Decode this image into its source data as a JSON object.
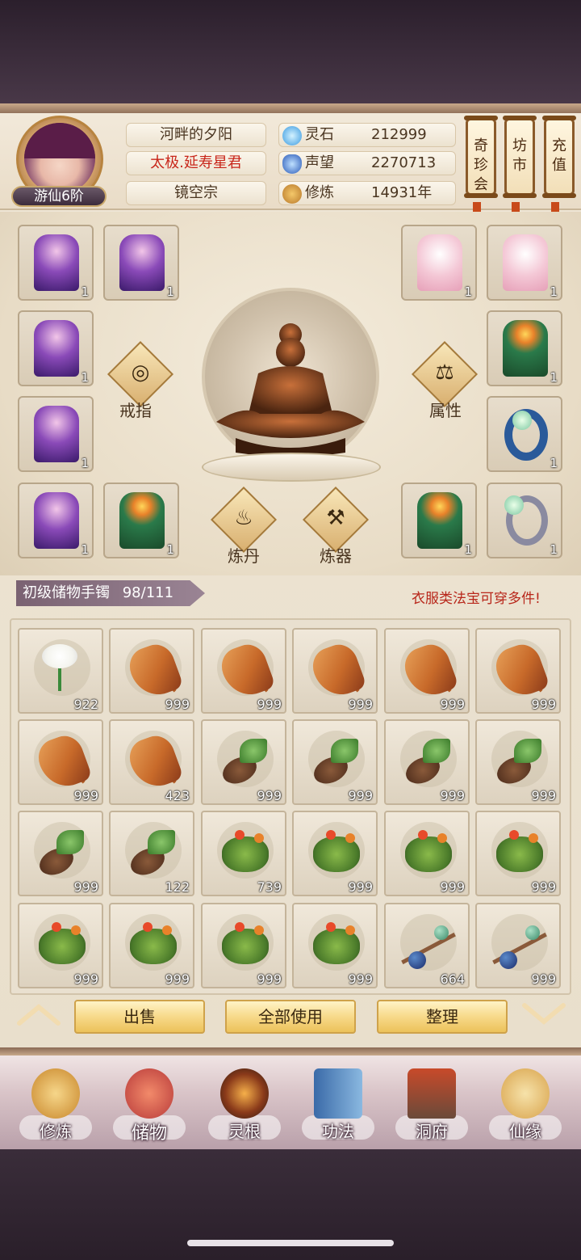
{
  "header": {
    "rank": "游仙6阶",
    "player_name": "河畔的夕阳",
    "title": "太极.延寿星君",
    "sect": "镜空宗",
    "stats": [
      {
        "label": "灵石",
        "value": "212999",
        "icon": "spirit-stone-icon"
      },
      {
        "label": "声望",
        "value": "2270713",
        "icon": "reputation-crystal-icon"
      },
      {
        "label": "修炼",
        "value": "14931年",
        "icon": "meditation-icon"
      }
    ],
    "shortcuts": [
      "奇珍会",
      "坊市",
      "充值"
    ]
  },
  "equipment": {
    "left_slots": [
      {
        "item": "purple-robe-icon",
        "count": "1"
      },
      {
        "item": "purple-robe-icon",
        "count": "1"
      },
      {
        "item": "purple-robe-icon",
        "count": "1"
      },
      {
        "item": "purple-robe-icon",
        "count": "1"
      },
      {
        "item": "purple-robe-icon",
        "count": "1"
      },
      {
        "item": "green-robe-icon",
        "count": "1"
      }
    ],
    "right_slots": [
      {
        "item": "pink-robe-icon",
        "count": "1"
      },
      {
        "item": "pink-robe-icon",
        "count": "1"
      },
      {
        "item": "green-robe-icon",
        "count": "1"
      },
      {
        "item": "blue-ring-icon",
        "count": "1"
      },
      {
        "item": "green-robe-icon",
        "count": "1"
      },
      {
        "item": "silver-ring-icon",
        "count": "1"
      }
    ],
    "buttons": {
      "ring": "戒指",
      "attributes": "属性",
      "alchemy": "炼丹",
      "forging": "炼器"
    }
  },
  "bag": {
    "name": "初级储物手镯",
    "capacity": "98/111",
    "note": "衣服类法宝可穿多件!",
    "items": [
      {
        "type": "lily",
        "count": "922"
      },
      {
        "type": "ginseng",
        "count": "999"
      },
      {
        "type": "ginseng",
        "count": "999"
      },
      {
        "type": "ginseng",
        "count": "999"
      },
      {
        "type": "ginseng",
        "count": "999"
      },
      {
        "type": "ginseng",
        "count": "999"
      },
      {
        "type": "ginseng",
        "count": "999"
      },
      {
        "type": "ginseng",
        "count": "423"
      },
      {
        "type": "bulb",
        "count": "999"
      },
      {
        "type": "bulb",
        "count": "999"
      },
      {
        "type": "bulb",
        "count": "999"
      },
      {
        "type": "bulb",
        "count": "999"
      },
      {
        "type": "bulb",
        "count": "999"
      },
      {
        "type": "bulb",
        "count": "122"
      },
      {
        "type": "bush",
        "count": "739"
      },
      {
        "type": "bush",
        "count": "999"
      },
      {
        "type": "bush",
        "count": "999"
      },
      {
        "type": "bush",
        "count": "999"
      },
      {
        "type": "bush",
        "count": "999"
      },
      {
        "type": "bush",
        "count": "999"
      },
      {
        "type": "bush",
        "count": "999"
      },
      {
        "type": "bush",
        "count": "999"
      },
      {
        "type": "berry",
        "count": "664"
      },
      {
        "type": "berry",
        "count": "999"
      }
    ],
    "actions": {
      "sell": "出售",
      "use_all": "全部使用",
      "sort": "整理"
    }
  },
  "nav": [
    {
      "label": "修炼",
      "icon": "cultivation-icon"
    },
    {
      "label": "储物",
      "icon": "storage-bag-icon"
    },
    {
      "label": "灵根",
      "icon": "spirit-root-icon"
    },
    {
      "label": "功法",
      "icon": "technique-book-icon"
    },
    {
      "label": "洞府",
      "icon": "cave-dwelling-icon"
    },
    {
      "label": "仙缘",
      "icon": "immortal-fate-icon"
    }
  ],
  "colors": {
    "warning": "#b8261a",
    "button_gold": "#f7d98a",
    "panel": "#efe6d6"
  }
}
